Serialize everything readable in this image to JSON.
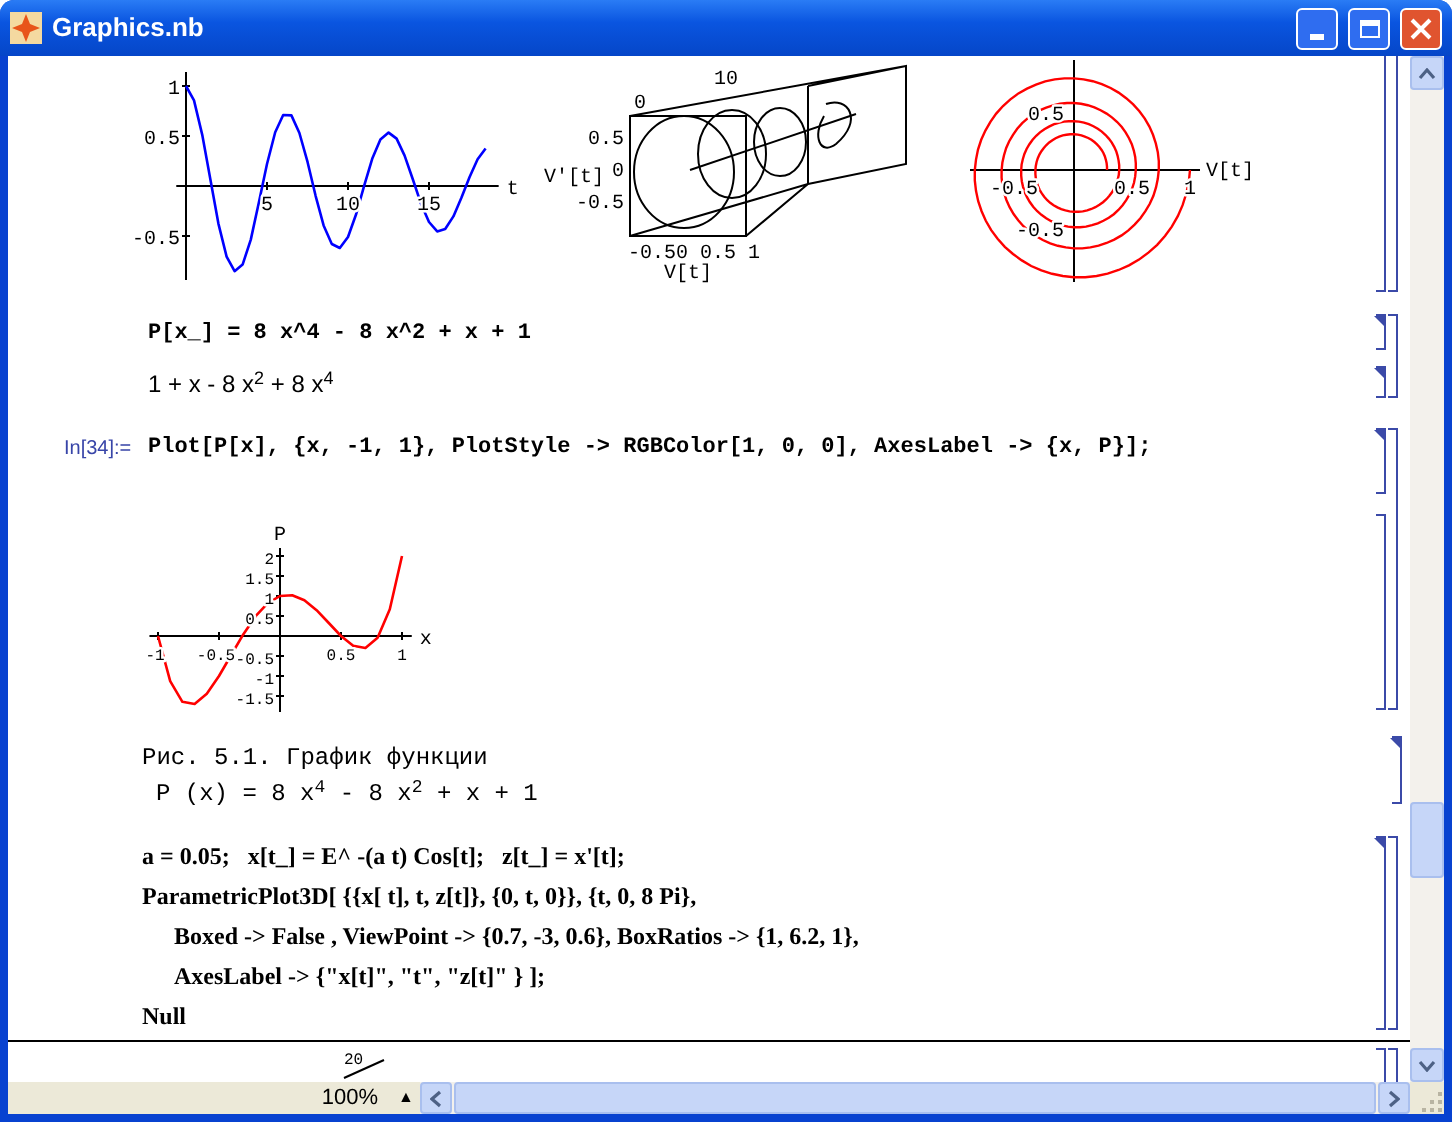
{
  "window": {
    "title": "Graphics.nb"
  },
  "plots_row": {
    "damped_plot": {
      "chart_data": {
        "type": "line",
        "xlabel": "t",
        "x": [
          0,
          0.5,
          1,
          1.5,
          2,
          2.5,
          3,
          3.5,
          4,
          4.5,
          5,
          5.5,
          6,
          6.5,
          7,
          7.5,
          8,
          8.5,
          9,
          9.5,
          10,
          10.5,
          11,
          11.5,
          12,
          12.5,
          13,
          13.5,
          14,
          14.5,
          15,
          15.5,
          16,
          16.5,
          17,
          17.5,
          18,
          18.5
        ],
        "series": [
          {
            "color": "#0000ff",
            "values": [
              1,
              0.856,
              0.514,
              0.066,
              -0.377,
              -0.707,
              -0.852,
              -0.786,
              -0.535,
              -0.168,
              0.221,
              0.538,
              0.711,
              0.706,
              0.531,
              0.238,
              -0.098,
              -0.394,
              -0.581,
              -0.62,
              -0.509,
              -0.281,
              0.003,
              0.272,
              0.463,
              0.534,
              0.474,
              0.303,
              0.068,
              -0.172,
              -0.359,
              -0.453,
              -0.43,
              -0.304,
              -0.118,
              0.09,
              0.268,
              0.377
            ]
          }
        ],
        "xticks": [
          5,
          10,
          15
        ],
        "yticks": [
          -0.5,
          0.5,
          1
        ],
        "xlim": [
          -0.6,
          19.3
        ],
        "ylim": [
          -0.94,
          1.14
        ]
      }
    },
    "box_plot": {
      "top_ticks": [
        "10",
        "0"
      ],
      "side_ticks": [
        "0.5",
        "0",
        "-0.5"
      ],
      "bottom_ticks": "-0.50 0.5 1",
      "side_label": "V'[t]",
      "bottom_label": "V[t]"
    },
    "spiral_plot": {
      "x_ticks": [
        "-0.5",
        "0.5",
        "1"
      ],
      "y_ticks": [
        "0.5",
        "-0.5"
      ],
      "x_label": "V[t]"
    }
  },
  "definition": {
    "input": "P[x_] = 8 x^4 - 8 x^2 + x + 1",
    "output": "1 + x - 8 x$^{2}$ + 8 x$^{4}$"
  },
  "plot_input": {
    "label": "In[34]:=",
    "code": "Plot[P[x], {x, -1, 1}, PlotStyle -> RGBColor[1, 0, 0], AxesLabel -> {x, P}];"
  },
  "polynomial_plot": {
    "chart_data": {
      "type": "line",
      "xlabel": "x",
      "ylabel": "P",
      "x": [
        -1,
        -0.9,
        -0.8,
        -0.7,
        -0.6,
        -0.5,
        -0.4,
        -0.3,
        -0.2,
        -0.1,
        0,
        0.1,
        0.2,
        0.3,
        0.4,
        0.5,
        0.6,
        0.7,
        0.8,
        0.9,
        1
      ],
      "series": [
        {
          "color": "#ff0000",
          "values": [
            0,
            -1.1312,
            -1.6432,
            -1.6992,
            -1.4432,
            -1,
            -0.4752,
            0.0448,
            0.4928,
            0.8208,
            1,
            1.0208,
            0.8928,
            0.6448,
            0.3248,
            0,
            -0.2432,
            -0.2992,
            -0.0432,
            0.6688,
            2
          ]
        }
      ],
      "xticks": [
        -1,
        -0.5,
        0.5,
        1
      ],
      "yticks": [
        -1.5,
        -1,
        -0.5,
        0.5,
        1,
        1.5,
        2
      ],
      "xlim": [
        -1.07,
        1.08
      ],
      "ylim": [
        -1.9,
        2.2
      ]
    }
  },
  "caption": {
    "lines": [
      "Рис. 5.1. График функции",
      "P (x) = 8 x$^{4}$ - 8 x$^{2}$ + x + 1"
    ]
  },
  "code_cell": {
    "lines": [
      {
        "kind": "statement",
        "text": "a = 0.05;   x[t_] = E^ -(a t) Cos[t];   z[t_] = x'[t];"
      },
      {
        "kind": "statement",
        "text": "ParametricPlot3D[ {{x[ t], t, z[t]}, {0, t, 0}}, {t, 0, 8 Pi},"
      },
      {
        "kind": "continuation",
        "text": "Boxed -> False , ViewPoint -> {0.7, -3, 0.6}, BoxRatios -> {1, 6.2, 1},"
      },
      {
        "kind": "continuation",
        "text": "AxesLabel -> {\"x[t]\", \"t\", \"z[t]\" } ];"
      },
      {
        "kind": "statement",
        "text": "Null"
      }
    ]
  },
  "cut_graphic": {
    "tick_label": "20"
  },
  "status_bar": {
    "zoom": "100%",
    "zoom_menu": "▲"
  }
}
